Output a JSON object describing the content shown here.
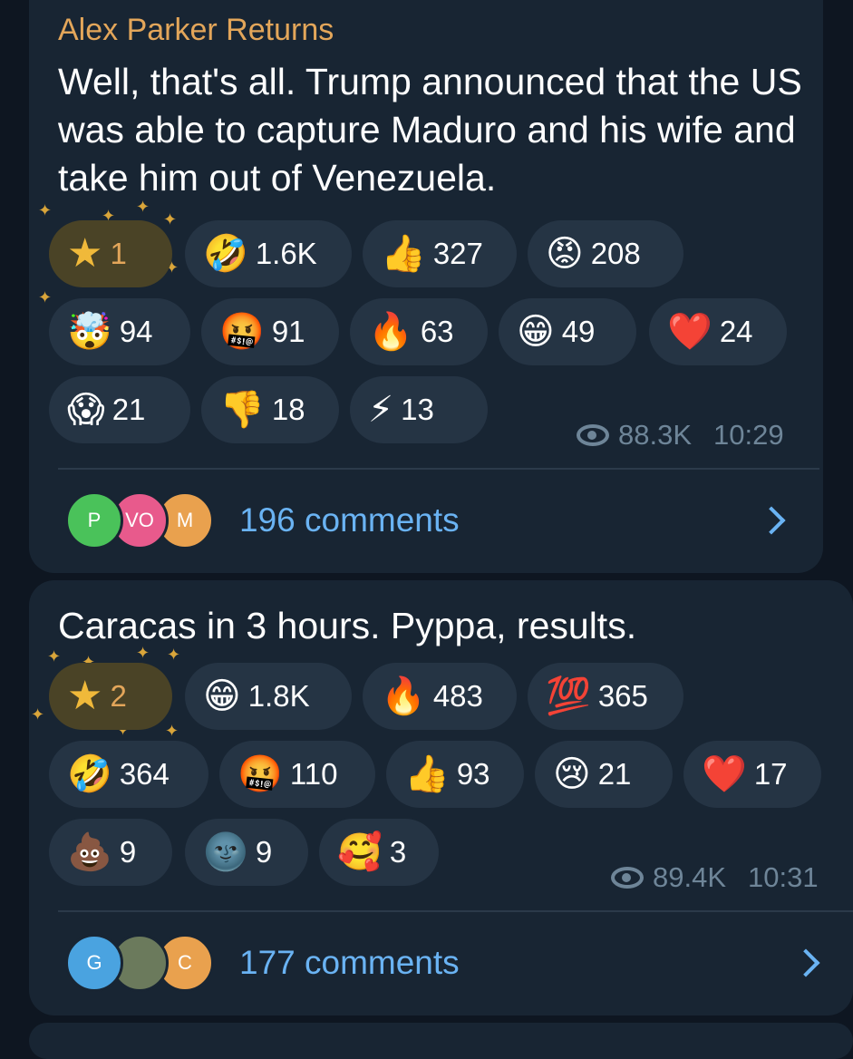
{
  "messages": [
    {
      "sender": "Alex Parker Returns",
      "text": "Well, that's all. Trump announced that the US was able to capture Maduro and his wife and take him out of Venezuela.",
      "reactions": [
        {
          "emoji": "star",
          "count": "1",
          "mine": true
        },
        {
          "emoji": "🤣",
          "count": "1.6K"
        },
        {
          "emoji": "👍",
          "count": "327"
        },
        {
          "emoji": "😡",
          "count": "208"
        },
        {
          "emoji": "🤯",
          "count": "94"
        },
        {
          "emoji": "🤬",
          "count": "91"
        },
        {
          "emoji": "🔥",
          "count": "63"
        },
        {
          "emoji": "😁",
          "count": "49"
        },
        {
          "emoji": "❤️",
          "count": "24"
        },
        {
          "emoji": "😱",
          "count": "21"
        },
        {
          "emoji": "👎",
          "count": "18"
        },
        {
          "emoji": "⚡",
          "count": "13"
        }
      ],
      "views": "88.3K",
      "time": "10:29",
      "comment_avatars": [
        {
          "initial": "P",
          "color": "#4ac25a"
        },
        {
          "initial": "VO",
          "color": "#e85a8c"
        },
        {
          "initial": "M",
          "color": "#e9a14e"
        }
      ],
      "comments_label": "196 comments"
    },
    {
      "text": "Caracas in 3 hours. Pyppa, results.",
      "reactions": [
        {
          "emoji": "star",
          "count": "2",
          "mine": true
        },
        {
          "emoji": "😁",
          "count": "1.8K"
        },
        {
          "emoji": "🔥",
          "count": "483"
        },
        {
          "emoji": "💯",
          "count": "365"
        },
        {
          "emoji": "🤣",
          "count": "364"
        },
        {
          "emoji": "🤬",
          "count": "110"
        },
        {
          "emoji": "👍",
          "count": "93"
        },
        {
          "emoji": "😢",
          "count": "21"
        },
        {
          "emoji": "❤️",
          "count": "17"
        },
        {
          "emoji": "💩",
          "count": "9"
        },
        {
          "emoji": "🌚",
          "count": "9"
        },
        {
          "emoji": "🥰",
          "count": "3"
        }
      ],
      "views": "89.4K",
      "time": "10:31",
      "comment_avatars": [
        {
          "initial": "G",
          "color": "#4aa3e0"
        },
        {
          "initial": "",
          "color": "#6b7a5c"
        },
        {
          "initial": "C",
          "color": "#e9a14e"
        }
      ],
      "comments_label": "177 comments"
    }
  ]
}
